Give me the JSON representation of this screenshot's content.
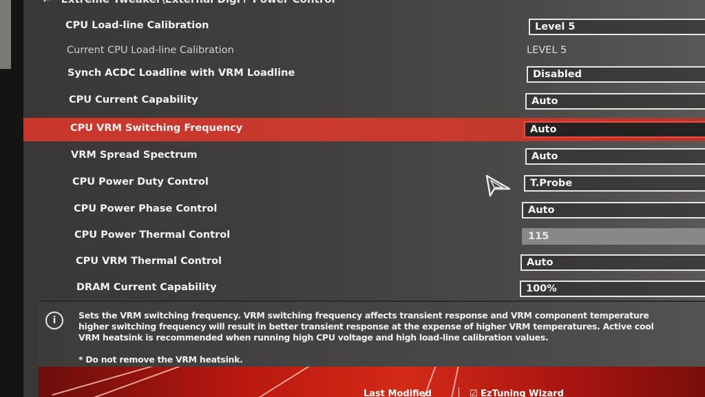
{
  "breadcrumb": {
    "back_icon": "back-arrow-icon",
    "path": "Extreme Tweaker\\External Digi+ Power Control"
  },
  "settings": [
    {
      "label": "CPU Load-line Calibration",
      "value": "Level 5",
      "type": "dropdown"
    },
    {
      "label": "Current CPU Load-line Calibration",
      "value": "LEVEL 5",
      "type": "readonly"
    },
    {
      "label": "Synch ACDC Loadline with VRM Loadline",
      "value": "Disabled",
      "type": "dropdown"
    },
    {
      "label": "CPU Current Capability",
      "value": "Auto",
      "type": "dropdown"
    },
    {
      "label": "CPU VRM Switching Frequency",
      "value": "Auto",
      "type": "dropdown",
      "selected": true
    },
    {
      "label": "VRM Spread Spectrum",
      "value": "Auto",
      "type": "dropdown"
    },
    {
      "label": "CPU Power Duty Control",
      "value": "T.Probe",
      "type": "dropdown"
    },
    {
      "label": "CPU Power Phase Control",
      "value": "Auto",
      "type": "dropdown"
    },
    {
      "label": "CPU Power Thermal Control",
      "value": "115",
      "type": "input-disabled"
    },
    {
      "label": "CPU VRM Thermal Control",
      "value": "Auto",
      "type": "dropdown"
    },
    {
      "label": "DRAM Current Capability",
      "value": "100%",
      "type": "dropdown"
    }
  ],
  "help": {
    "icon": "info-icon",
    "lines": [
      "Sets the VRM switching frequency.  VRM switching frequency affects transient response and VRM component temperature",
      "higher switching frequency will result in better transient response at the expense of higher VRM temperatures. Active cool",
      "VRM heatsink is recommended when running high CPU voltage and high load-line calibration values.",
      "* Do not remove the VRM heatsink."
    ]
  },
  "footer": {
    "last_modified": "Last Modified",
    "ez_tuning": "☑ EzTuning Wizard"
  },
  "colors": {
    "selected_row": "#c8372b",
    "selected_border": "#ef4b3c",
    "footer_red": "#d42a18"
  }
}
